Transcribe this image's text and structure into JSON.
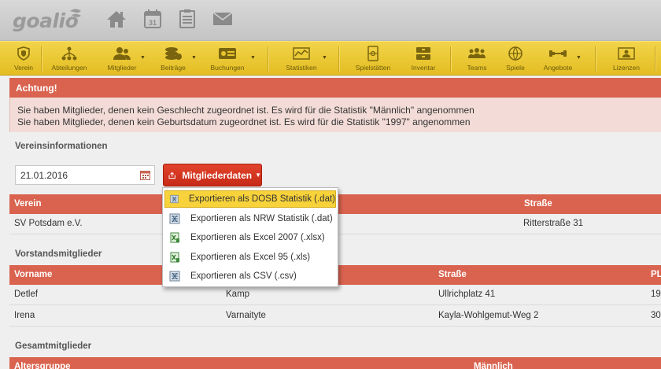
{
  "header": {
    "logo_text": "goalio",
    "calendar_day": "31",
    "icons": [
      "home-icon",
      "calendar-icon",
      "tasks-icon",
      "mail-icon"
    ]
  },
  "toolbar": {
    "items": [
      {
        "label": "Verein",
        "icon": "shield-icon"
      },
      {
        "label": "Abteilungen",
        "icon": "hierarchy-icon"
      },
      {
        "label": "Mitglieder",
        "icon": "members-icon"
      },
      {
        "label": "Beiträge",
        "icon": "coins-icon"
      },
      {
        "label": "Buchungen",
        "icon": "bookings-icon"
      },
      {
        "label": "Statistiken",
        "icon": "chart-icon"
      },
      {
        "label": "Spielstätten",
        "icon": "field-icon"
      },
      {
        "label": "Inventar",
        "icon": "inventory-icon"
      },
      {
        "label": "Teams",
        "icon": "team-icon"
      },
      {
        "label": "Spiele",
        "icon": "ball-icon"
      },
      {
        "label": "Angebote",
        "icon": "dumbbell-icon"
      },
      {
        "label": "Lizenzen",
        "icon": "license-icon"
      }
    ]
  },
  "alert": {
    "title": "Achtung!",
    "line1": "Sie haben Mitglieder, denen kein Geschlecht zugeordnet ist. Es wird für die Statistik \"Männlich\" angenommen",
    "line2": "Sie haben Mitglieder, denen kein Geburtsdatum zugeordnet ist. Es wird für die Statistik \"1997\" angenommen"
  },
  "verein_section": {
    "title": "Vereinsinformationen",
    "date_value": "21.01.2016",
    "export_button": "Mitgliederdaten",
    "columns": [
      "Verein",
      "Straße"
    ],
    "rows": [
      [
        "SV Potsdam e.V.",
        "Ritterstraße 31"
      ]
    ]
  },
  "export_menu": {
    "items": [
      {
        "label": "Exportieren als DOSB Statistik (.dat)",
        "icon": "dat-file-icon",
        "active": true
      },
      {
        "label": "Exportieren als NRW Statistik (.dat)",
        "icon": "dat-file-icon",
        "active": false
      },
      {
        "label": "Exportieren als Excel 2007 (.xlsx)",
        "icon": "excel-file-icon",
        "active": false
      },
      {
        "label": "Exportieren als Excel 95 (.xls)",
        "icon": "excel-file-icon",
        "active": false
      },
      {
        "label": "Exportieren als CSV (.csv)",
        "icon": "csv-file-icon",
        "active": false
      }
    ]
  },
  "vorstand_section": {
    "title": "Vorstandsmitglieder",
    "columns": [
      "Vorname",
      "Straße",
      "PL"
    ],
    "rows": [
      [
        "Detlef",
        "Kamp",
        "Ullrichplatz 41",
        "19"
      ],
      [
        "Irena",
        "Varnaityte",
        "Kayla-Wohlgemut-Weg 2",
        "30"
      ]
    ]
  },
  "gesamt_section": {
    "title": "Gesamtmitglieder",
    "columns": [
      "Altersgruppe",
      "Männlich"
    ]
  },
  "colors": {
    "toolbar_yellow": "#e8c52e",
    "header_red": "#d9634f",
    "button_red": "#d23820",
    "alert_bg": "#f3dcd7",
    "menu_highlight": "#f7d23a"
  }
}
